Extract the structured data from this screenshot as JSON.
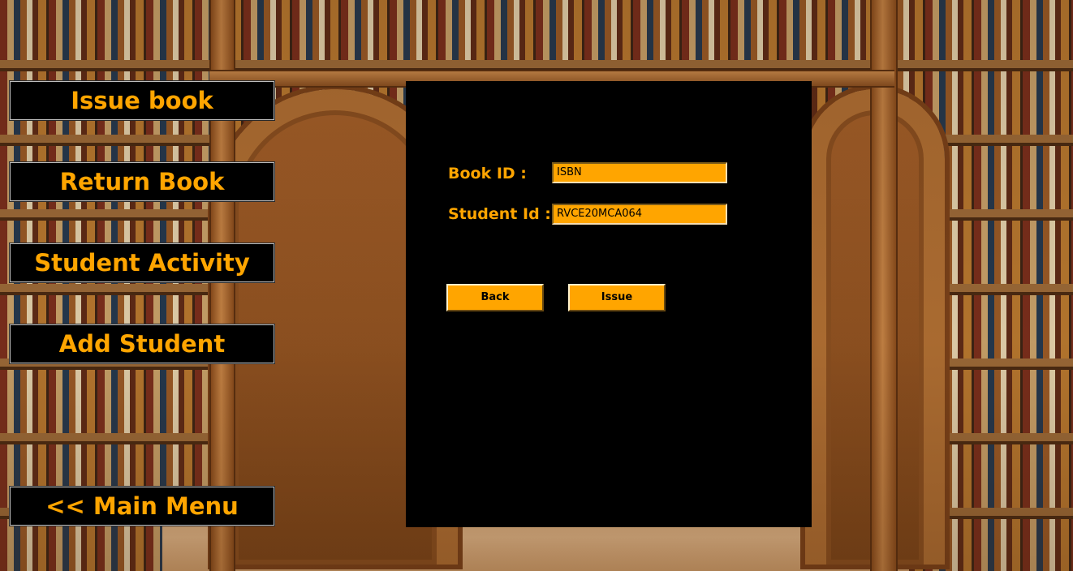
{
  "sidebar": {
    "items": [
      {
        "label": "Issue book"
      },
      {
        "label": "Return Book"
      },
      {
        "label": "Student Activity"
      },
      {
        "label": "Add Student"
      }
    ],
    "main_menu_label": "<< Main Menu"
  },
  "form": {
    "book_id": {
      "label": "Book ID :",
      "value": "ISBN"
    },
    "student_id": {
      "label": "Student Id :",
      "value": "RVCE20MCA064"
    },
    "back_label": "Back",
    "issue_label": "Issue"
  },
  "colors": {
    "accent": "#ffa500",
    "panel": "#000000",
    "background_wood": "#b06f33"
  },
  "icons": {
    "background": "library-bookshelves-image"
  }
}
